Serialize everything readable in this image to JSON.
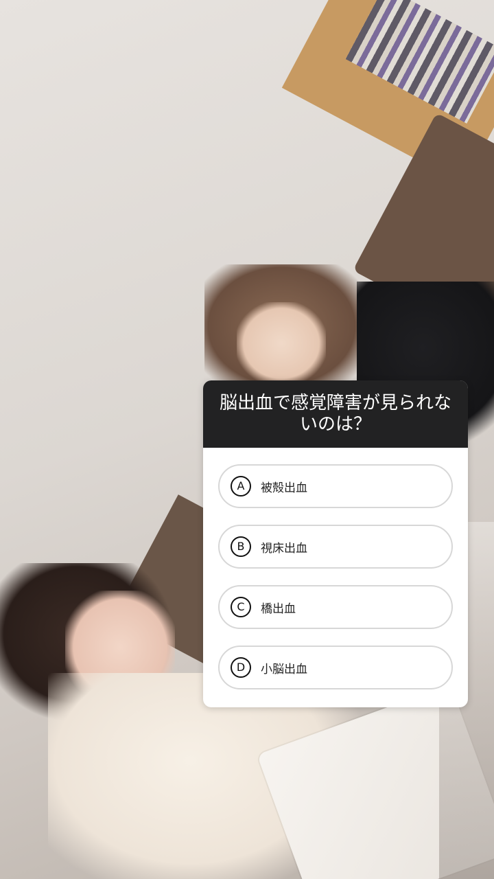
{
  "quiz": {
    "question": "脳出血で感覚障害が見られないのは？",
    "options": [
      {
        "letter": "A",
        "label": "被殻出血"
      },
      {
        "letter": "B",
        "label": "視床出血"
      },
      {
        "letter": "C",
        "label": "橋出血"
      },
      {
        "letter": "D",
        "label": "小脳出血"
      }
    ]
  },
  "colors": {
    "header_bg": "#222223",
    "card_bg": "#ffffff",
    "option_border": "#d7d7d7"
  }
}
